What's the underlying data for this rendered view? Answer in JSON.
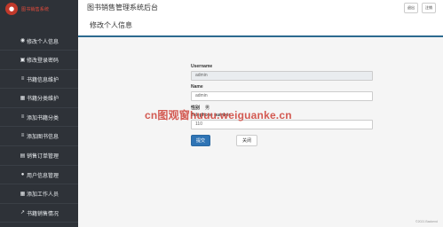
{
  "brand": {
    "logo_text": "图书销售系统"
  },
  "app": {
    "title": "图书销售管理系统后台"
  },
  "top_actions": [
    {
      "label": "退出"
    },
    {
      "label": "注销"
    }
  ],
  "sidebar": {
    "items": [
      {
        "label": "修改个人信息",
        "icon": "user-circle-icon"
      },
      {
        "label": "修改登录密码",
        "icon": "lock-icon"
      },
      {
        "label": "书籍信息维护",
        "icon": "list-icon"
      },
      {
        "label": "书籍分类维护",
        "icon": "grid-icon"
      },
      {
        "label": "添加书籍分类",
        "icon": "list-icon"
      },
      {
        "label": "添加图书信息",
        "icon": "list-icon"
      },
      {
        "label": "销售订单管理",
        "icon": "book-icon"
      },
      {
        "label": "用户信息管理",
        "icon": "user-icon"
      },
      {
        "label": "添加工作人员",
        "icon": "grid-icon"
      },
      {
        "label": "书籍销售情况",
        "icon": "chart-icon"
      }
    ]
  },
  "page": {
    "title": "修改个人信息"
  },
  "form": {
    "username_label": "Username",
    "username_value": "admin",
    "name_label": "Name",
    "name_value": "admin",
    "sex_label": "性别",
    "sex_value": "男",
    "telephone_label": "Telephone number",
    "telephone_value": "110",
    "submit_label": "提交",
    "close_label": "关闭"
  },
  "watermark": {
    "text": "cn图观窗huuu.weiguanke.cn"
  },
  "footer": {
    "text": "©2021 Backend"
  }
}
